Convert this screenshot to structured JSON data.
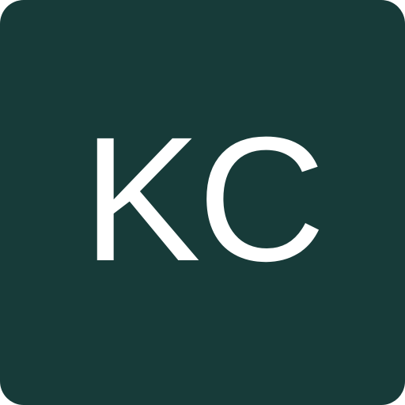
{
  "avatar": {
    "initials": "KC",
    "background_color": "#173b39",
    "text_color": "#ffffff"
  }
}
